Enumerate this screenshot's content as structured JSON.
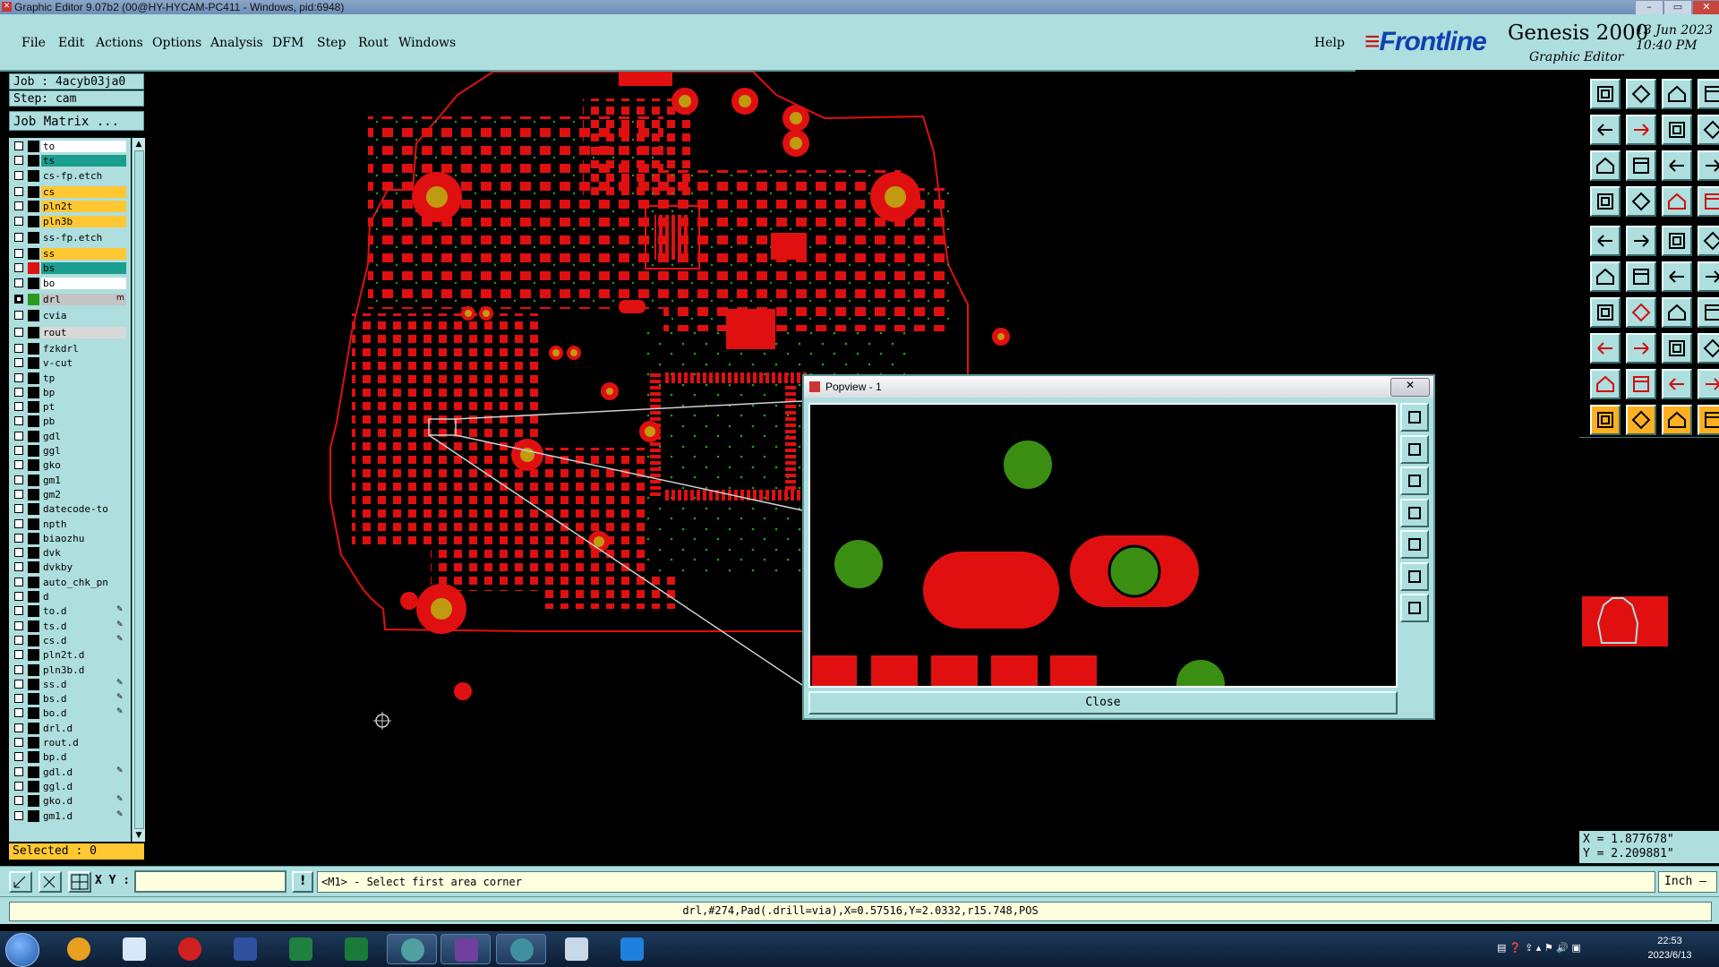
{
  "window": {
    "title": "Graphic Editor 9.07b2 (00@HY-HYCAM-PC411 - Windows, pid:6948)"
  },
  "menu": {
    "items": [
      "File",
      "Edit",
      "Actions",
      "Options",
      "Analysis",
      "DFM",
      "Step",
      "Rout",
      "Windows"
    ],
    "help": "Help"
  },
  "brand": {
    "logo": "Frontline",
    "product": "Genesis 2000",
    "subtitle": "Graphic Editor",
    "date": "13 Jun 2023",
    "time": "10:40 PM"
  },
  "job": {
    "job_label": "Job : 4acyb03ja0",
    "step_label": "Step: cam",
    "matrix_button": "Job Matrix ..."
  },
  "layers": [
    {
      "name": "to",
      "color": "#ffffff",
      "checked": false,
      "swatch": ""
    },
    {
      "name": "ts",
      "color": "#1a9e8e",
      "checked": false,
      "swatch": ""
    },
    {
      "name": "cs-fp.etch",
      "color": "#aedede",
      "checked": false,
      "swatch": ""
    },
    {
      "name": "cs",
      "color": "#ffc832",
      "checked": false,
      "swatch": ""
    },
    {
      "name": "pln2t",
      "color": "#ffc832",
      "checked": false,
      "swatch": ""
    },
    {
      "name": "pln3b",
      "color": "#ffc832",
      "checked": false,
      "swatch": ""
    },
    {
      "name": "ss-fp.etch",
      "color": "#aedede",
      "checked": false,
      "swatch": ""
    },
    {
      "name": "ss",
      "color": "#ffc832",
      "checked": false,
      "swatch": ""
    },
    {
      "name": "bs",
      "color": "#1a9e8e",
      "checked": false,
      "swatch": "#e01010"
    },
    {
      "name": "bo",
      "color": "#ffffff",
      "checked": false,
      "swatch": ""
    },
    {
      "name": "drl",
      "color": "#c4c4c4",
      "checked": true,
      "swatch": "#2a9a20",
      "mark": "m"
    },
    {
      "name": "cvia",
      "color": "#aedede",
      "checked": false,
      "swatch": ""
    },
    {
      "name": "rout",
      "color": "#d8d8d8",
      "checked": false,
      "swatch": ""
    },
    {
      "name": "fzkdrl",
      "color": "#aedede",
      "checked": false,
      "swatch": ""
    },
    {
      "name": "v-cut",
      "color": "#aedede",
      "checked": false,
      "swatch": ""
    },
    {
      "name": "tp",
      "color": "#aedede",
      "checked": false,
      "swatch": ""
    },
    {
      "name": "bp",
      "color": "#aedede",
      "checked": false,
      "swatch": ""
    },
    {
      "name": "pt",
      "color": "#aedede",
      "checked": false,
      "swatch": ""
    },
    {
      "name": "pb",
      "color": "#aedede",
      "checked": false,
      "swatch": ""
    },
    {
      "name": "gdl",
      "color": "#aedede",
      "checked": false,
      "swatch": ""
    },
    {
      "name": "ggl",
      "color": "#aedede",
      "checked": false,
      "swatch": ""
    },
    {
      "name": "gko",
      "color": "#aedede",
      "checked": false,
      "swatch": ""
    },
    {
      "name": "gm1",
      "color": "#aedede",
      "checked": false,
      "swatch": ""
    },
    {
      "name": "gm2",
      "color": "#aedede",
      "checked": false,
      "swatch": ""
    },
    {
      "name": "datecode-to",
      "color": "#aedede",
      "checked": false,
      "swatch": ""
    },
    {
      "name": "npth",
      "color": "#aedede",
      "checked": false,
      "swatch": ""
    },
    {
      "name": "biaozhu",
      "color": "#aedede",
      "checked": false,
      "swatch": ""
    },
    {
      "name": "dvk",
      "color": "#aedede",
      "checked": false,
      "swatch": ""
    },
    {
      "name": "dvkby",
      "color": "#aedede",
      "checked": false,
      "swatch": ""
    },
    {
      "name": "auto_chk_pn",
      "color": "#aedede",
      "checked": false,
      "swatch": ""
    },
    {
      "name": "d",
      "color": "#aedede",
      "checked": false,
      "swatch": ""
    },
    {
      "name": "to.d",
      "color": "#aedede",
      "checked": false,
      "swatch": "",
      "mark": "✎"
    },
    {
      "name": "ts.d",
      "color": "#aedede",
      "checked": false,
      "swatch": "",
      "mark": "✎"
    },
    {
      "name": "cs.d",
      "color": "#aedede",
      "checked": false,
      "swatch": "",
      "mark": "✎"
    },
    {
      "name": "pln2t.d",
      "color": "#aedede",
      "checked": false,
      "swatch": ""
    },
    {
      "name": "pln3b.d",
      "color": "#aedede",
      "checked": false,
      "swatch": ""
    },
    {
      "name": "ss.d",
      "color": "#aedede",
      "checked": false,
      "swatch": "",
      "mark": "✎"
    },
    {
      "name": "bs.d",
      "color": "#aedede",
      "checked": false,
      "swatch": "",
      "mark": "✎"
    },
    {
      "name": "bo.d",
      "color": "#aedede",
      "checked": false,
      "swatch": "",
      "mark": "✎"
    },
    {
      "name": "drl.d",
      "color": "#aedede",
      "checked": false,
      "swatch": ""
    },
    {
      "name": "rout.d",
      "color": "#aedede",
      "checked": false,
      "swatch": ""
    },
    {
      "name": "bp.d",
      "color": "#aedede",
      "checked": false,
      "swatch": ""
    },
    {
      "name": "gdl.d",
      "color": "#aedede",
      "checked": false,
      "swatch": "",
      "mark": "✎"
    },
    {
      "name": "ggl.d",
      "color": "#aedede",
      "checked": false,
      "swatch": ""
    },
    {
      "name": "gko.d",
      "color": "#aedede",
      "checked": false,
      "swatch": "",
      "mark": "✎"
    },
    {
      "name": "gm1.d",
      "color": "#aedede",
      "checked": false,
      "swatch": "",
      "mark": "✎"
    }
  ],
  "selection": {
    "label": "Selected : 0"
  },
  "coords": {
    "x": "X = 1.877678\"",
    "y": "Y = 2.209881\""
  },
  "command": {
    "xy_label": "X Y :",
    "xy_value": "",
    "prompt": "<M1> - Select first area corner",
    "unit": "Inch —"
  },
  "status": {
    "text": "drl,#274,Pad(.drill=via),X=0.57516,Y=2.0332,r15.748,POS"
  },
  "popview": {
    "title": "Popview - 1",
    "close_button": "Close",
    "close_x": "✕"
  },
  "taskbar": {
    "time": "22:53",
    "date": "2023/6/13"
  },
  "colors": {
    "panel": "#aedede",
    "copper": "#e01010",
    "drill": "#2a9a20",
    "highlight": "#ffc832"
  }
}
